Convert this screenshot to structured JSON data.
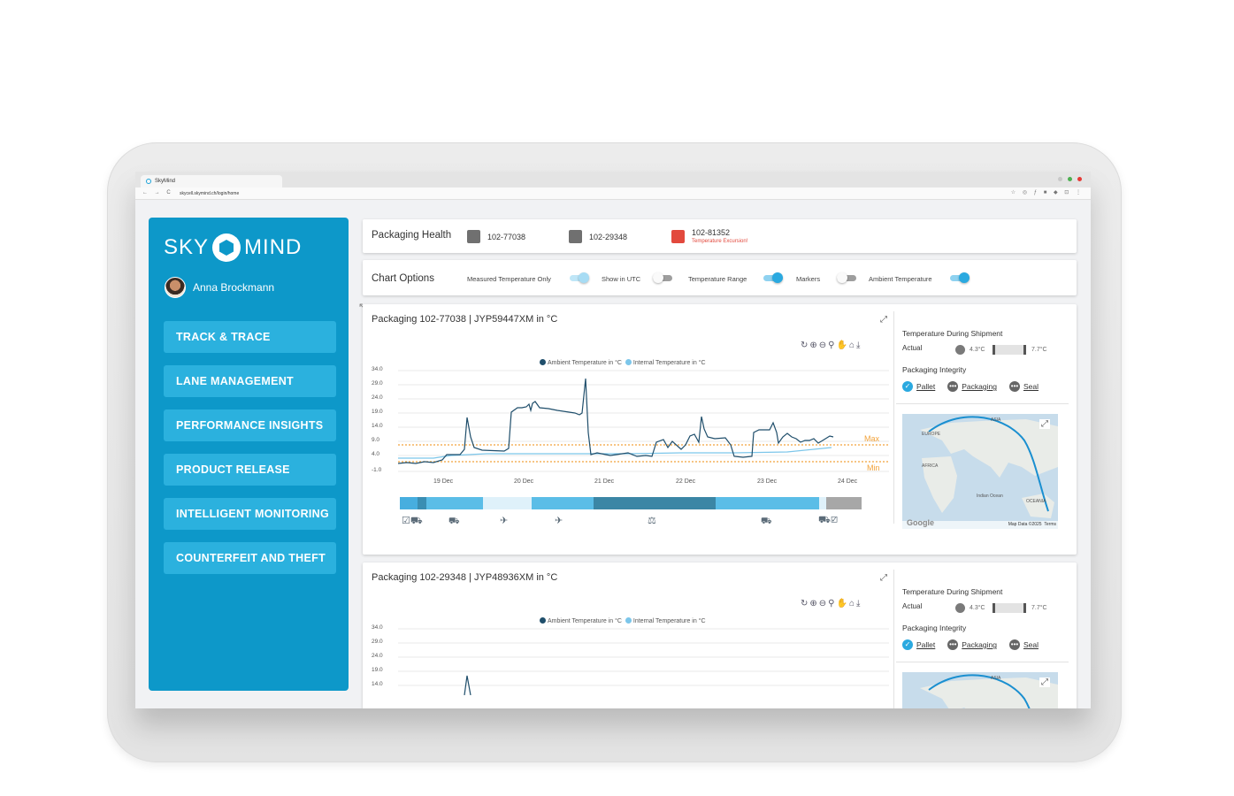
{
  "browser": {
    "tab_title": "SkyMind",
    "url": "skycell.skymind.ch/login/home"
  },
  "brand": {
    "left": "SKY",
    "right": "MIND",
    "accent": "#0d98c9"
  },
  "user": {
    "name": "Anna Brockmann"
  },
  "menu": [
    {
      "label": "TRACK & TRACE"
    },
    {
      "label": "LANE MANAGEMENT"
    },
    {
      "label": "PERFORMANCE INSIGHTS"
    },
    {
      "label": "PRODUCT RELEASE"
    },
    {
      "label": "INTELLIGENT MONITORING"
    },
    {
      "label": "COUNTERFEIT AND THEFT"
    }
  ],
  "health": {
    "title": "Packaging Health",
    "items": [
      {
        "id": "102-77038",
        "status_color": "#707070"
      },
      {
        "id": "102-29348",
        "status_color": "#707070"
      },
      {
        "id": "102-81352",
        "status_color": "#e2493d",
        "note": "Temperature Excursion!"
      }
    ]
  },
  "options": {
    "title": "Chart Options",
    "toggles": [
      {
        "label": "Measured Temperature Only",
        "on": true,
        "style": "light"
      },
      {
        "label": "Show in UTC",
        "on": false
      },
      {
        "label": "Temperature Range",
        "on": true
      },
      {
        "label": "Markers",
        "on": false
      },
      {
        "label": "Ambient Temperature",
        "on": true
      }
    ]
  },
  "packages": [
    {
      "title": "Packaging 102-77038 | JYP59447XM in °C",
      "legend": {
        "ambient": "Ambient Temperature in °C",
        "internal": "Internal Temperature in °C"
      },
      "yticks": [
        "34.0",
        "29.0",
        "24.0",
        "19.0",
        "14.0",
        "9.0",
        "4.0",
        "-1.0"
      ],
      "xticks": [
        "19 Dec",
        "20 Dec",
        "21 Dec",
        "22 Dec",
        "23 Dec",
        "24 Dec"
      ],
      "max_label": "Max",
      "min_label": "Min",
      "panel": {
        "temp_title": "Temperature During Shipment",
        "actual_label": "Actual",
        "t_min": "4.3°C",
        "t_max": "7.7°C",
        "integrity_title": "Packaging Integrity",
        "integrity": [
          "Pallet",
          "Packaging",
          "Seal"
        ]
      },
      "map": {
        "labels": [
          "ASIA",
          "EUROPE",
          "AFRICA",
          "Indian Ocean",
          "OCEANIA"
        ],
        "google": "Google",
        "data": "Map Data ©2025",
        "terms": "Terms"
      }
    },
    {
      "title": "Packaging 102-29348 | JYP48936XM in °C",
      "legend": {
        "ambient": "Ambient Temperature in °C",
        "internal": "Internal Temperature in °C"
      },
      "yticks": [
        "34.0",
        "29.0",
        "24.0",
        "19.0",
        "14.0"
      ],
      "panel": {
        "temp_title": "Temperature During Shipment",
        "actual_label": "Actual",
        "t_min": "4.3°C",
        "t_max": "7.7°C",
        "integrity_title": "Packaging Integrity",
        "integrity": [
          "Pallet",
          "Packaging",
          "Seal"
        ]
      },
      "map": {
        "labels": [
          "ASIA"
        ]
      }
    }
  ]
}
